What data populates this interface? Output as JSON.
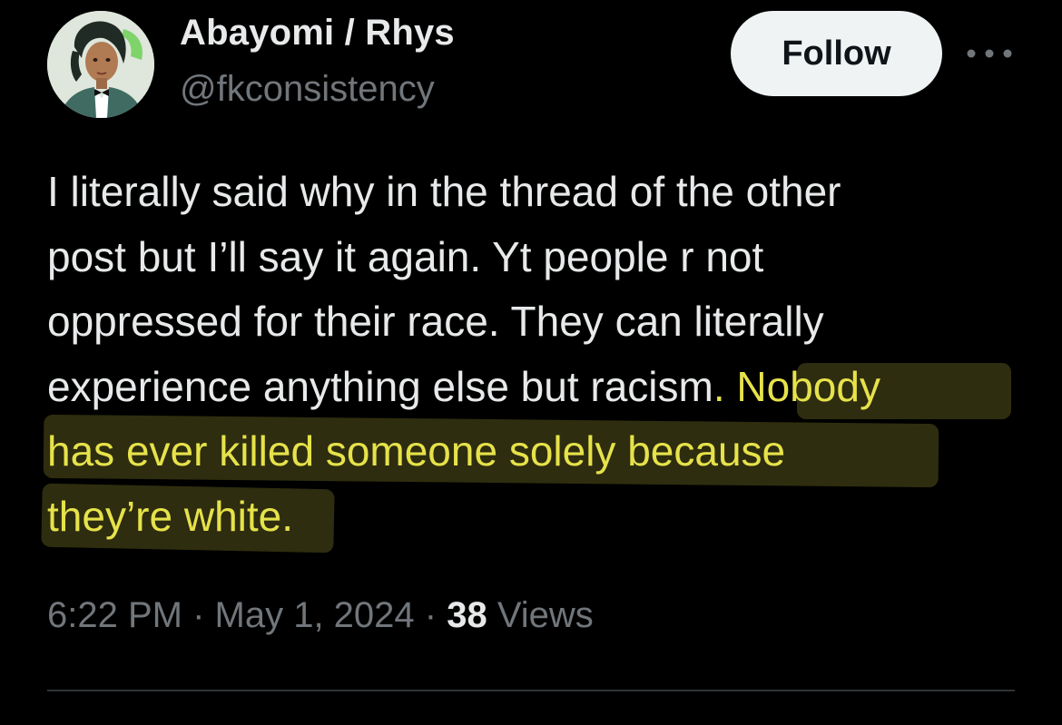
{
  "author": {
    "display_name": "Abayomi / Rhys",
    "handle": "@fkconsistency",
    "avatar_icon": "illustrated-profile-avatar"
  },
  "actions": {
    "follow_label": "Follow",
    "more_icon": "more-horizontal-icon"
  },
  "tweet": {
    "lines": [
      "I literally said why in the thread of the other",
      "post but I’ll say it again. Yt people r not",
      "oppressed for their race. They can literally",
      "experience anything else but racism"
    ],
    "highlight_lead": ". Nobody",
    "highlight_lines": [
      "has ever killed someone  solely because",
      "they’re white."
    ],
    "highlight_color": "#e6e24a"
  },
  "meta": {
    "time": "6:22 PM",
    "separator": " · ",
    "date": "May 1, 2024",
    "views_count": "38",
    "views_label": "Views"
  },
  "colors": {
    "background": "#000000",
    "primary_text": "#e7e9ea",
    "secondary_text": "#71767b",
    "follow_bg": "#eff3f4",
    "divider": "#2f3336"
  }
}
